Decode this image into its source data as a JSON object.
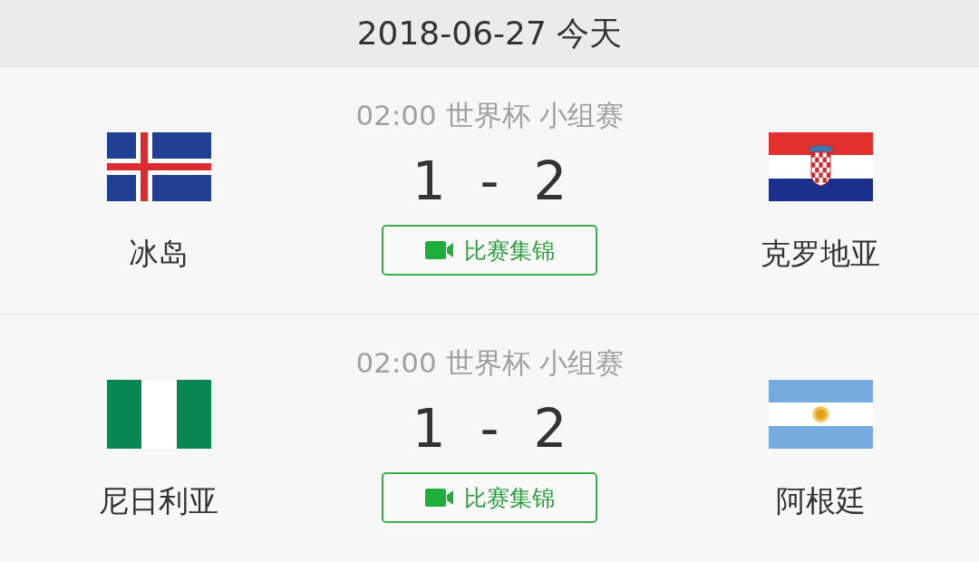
{
  "header": {
    "title": "2018-06-27 今天"
  },
  "matches": [
    {
      "info": "02:00 世界杯 小组赛",
      "teams": [
        {
          "name": "冰岛",
          "kind": "iceland"
        },
        {
          "name": "克罗地亚",
          "kind": "croatia"
        }
      ],
      "score": {
        "home": "1",
        "separator": "-",
        "away": "2"
      },
      "highlights_button": "比赛集锦"
    },
    {
      "info": "02:00 世界杯 小组赛",
      "teams": [
        {
          "name": "尼日利亚",
          "kind": "nigeria"
        },
        {
          "name": "阿根廷",
          "kind": "argentina"
        }
      ],
      "score": {
        "home": "1",
        "separator": "-",
        "away": "2"
      },
      "highlights_button": "比赛集锦"
    }
  ]
}
